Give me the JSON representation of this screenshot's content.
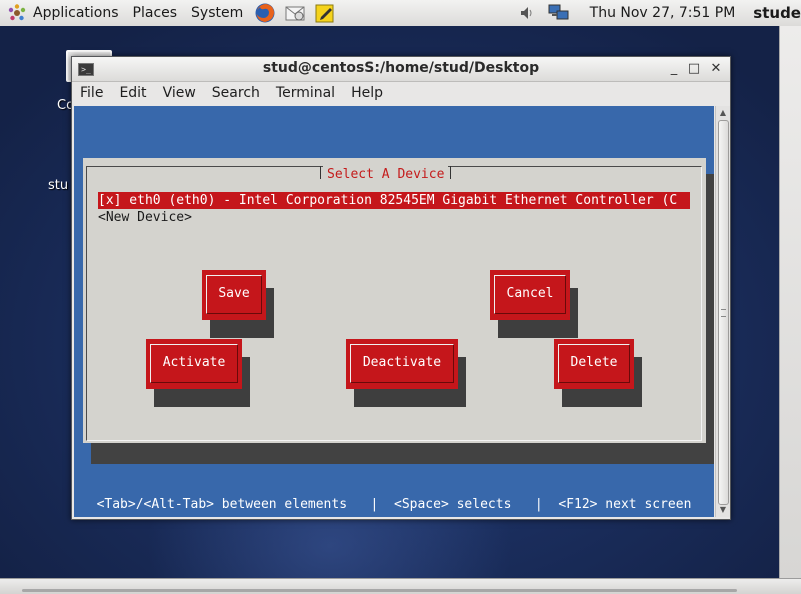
{
  "top_panel": {
    "menus": [
      "Applications",
      "Places",
      "System"
    ],
    "launchers": [
      "firefox-icon",
      "mail-icon",
      "notes-icon"
    ],
    "clock": "Thu Nov 27,  7:51 PM",
    "user": "stude",
    "tray": [
      "volume-icon",
      "network-icon"
    ]
  },
  "desktop": {
    "icon_labels": [
      "Co",
      "stu"
    ]
  },
  "window": {
    "title": "stud@centosS:/home/stud/Desktop",
    "menu": [
      "File",
      "Edit",
      "View",
      "Search",
      "Terminal",
      "Help"
    ],
    "controls": [
      "_",
      "□",
      "✕"
    ]
  },
  "tui": {
    "dialog_title": "Select A Device",
    "devices": [
      "[x] eth0 (eth0) - Intel Corporation 82545EM Gigabit Ethernet Controller (C",
      "<New Device>"
    ],
    "buttons": {
      "save": "Save",
      "cancel": "Cancel",
      "activate": "Activate",
      "deactivate": "Deactivate",
      "delete": "Delete"
    },
    "status": "<Tab>/<Alt-Tab> between elements   |  <Space> selects   |  <F12> next screen"
  },
  "colors": {
    "terminal_bg": "#3868ab",
    "dialog_bg": "#d4d3ce",
    "accent_red": "#c5161b",
    "title_red": "#c41b1b"
  }
}
